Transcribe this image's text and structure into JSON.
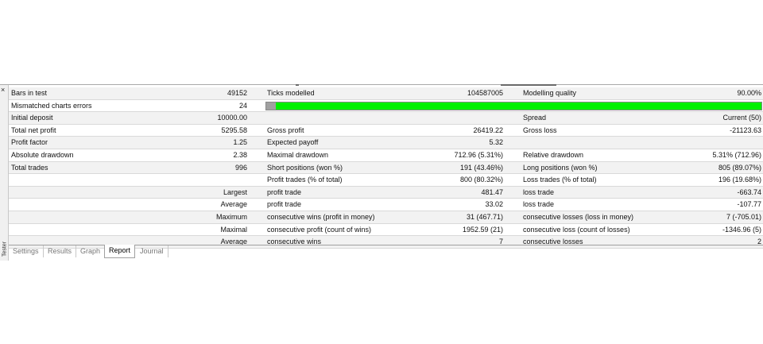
{
  "window": {
    "close_glyph": "×",
    "side_label": "Tester"
  },
  "rows": [
    {
      "c1": "Bars in test",
      "c2": "49152",
      "c3": "Ticks modelled",
      "c4": "104587005",
      "c5": "Modelling quality",
      "c6": "90.00%"
    },
    {
      "c1": "Mismatched charts errors",
      "c2": "24",
      "c3": "",
      "c4": "",
      "c5": "",
      "c6": ""
    },
    {
      "c1": "Initial deposit",
      "c2": "10000.00",
      "c3": "",
      "c4": "",
      "c5": "Spread",
      "c6": "Current (50)"
    },
    {
      "c1": "Total net profit",
      "c2": "5295.58",
      "c3": "Gross profit",
      "c4": "26419.22",
      "c5": "Gross loss",
      "c6": "-21123.63"
    },
    {
      "c1": "Profit factor",
      "c2": "1.25",
      "c3": "Expected payoff",
      "c4": "5.32",
      "c5": "",
      "c6": ""
    },
    {
      "c1": "Absolute drawdown",
      "c2": "2.38",
      "c3": "Maximal drawdown",
      "c4": "712.96 (5.31%)",
      "c5": "Relative drawdown",
      "c6": "5.31% (712.96)"
    },
    {
      "c1": "Total trades",
      "c2": "996",
      "c3": "Short positions (won %)",
      "c4": "191 (43.46%)",
      "c5": "Long positions (won %)",
      "c6": "805 (89.07%)"
    },
    {
      "c1": "",
      "c2": "",
      "c3": "Profit trades (% of total)",
      "c4": "800 (80.32%)",
      "c5": "Loss trades (% of total)",
      "c6": "196 (19.68%)"
    },
    {
      "c1": "",
      "c2": "Largest",
      "c3": "profit trade",
      "c4": "481.47",
      "c5": "loss trade",
      "c6": "-663.74"
    },
    {
      "c1": "",
      "c2": "Average",
      "c3": "profit trade",
      "c4": "33.02",
      "c5": "loss trade",
      "c6": "-107.77"
    },
    {
      "c1": "",
      "c2": "Maximum",
      "c3": "consecutive wins (profit in money)",
      "c4": "31 (467.71)",
      "c5": "consecutive losses (loss in money)",
      "c6": "7 (-705.01)"
    },
    {
      "c1": "",
      "c2": "Maximal",
      "c3": "consecutive profit (count of wins)",
      "c4": "1952.59 (21)",
      "c5": "consecutive loss (count of losses)",
      "c6": "-1346.96 (5)"
    },
    {
      "c1": "",
      "c2": "Average",
      "c3": "consecutive wins",
      "c4": "7",
      "c5": "consecutive losses",
      "c6": "2"
    }
  ],
  "quality_bar": {
    "mismatch_fraction": 0.02,
    "color_ok": "#00f000",
    "color_error": "#a0a0a0"
  },
  "tabs": [
    {
      "label": "Settings",
      "active": false
    },
    {
      "label": "Results",
      "active": false
    },
    {
      "label": "Graph",
      "active": false
    },
    {
      "label": "Report",
      "active": true
    },
    {
      "label": "Journal",
      "active": false
    }
  ]
}
